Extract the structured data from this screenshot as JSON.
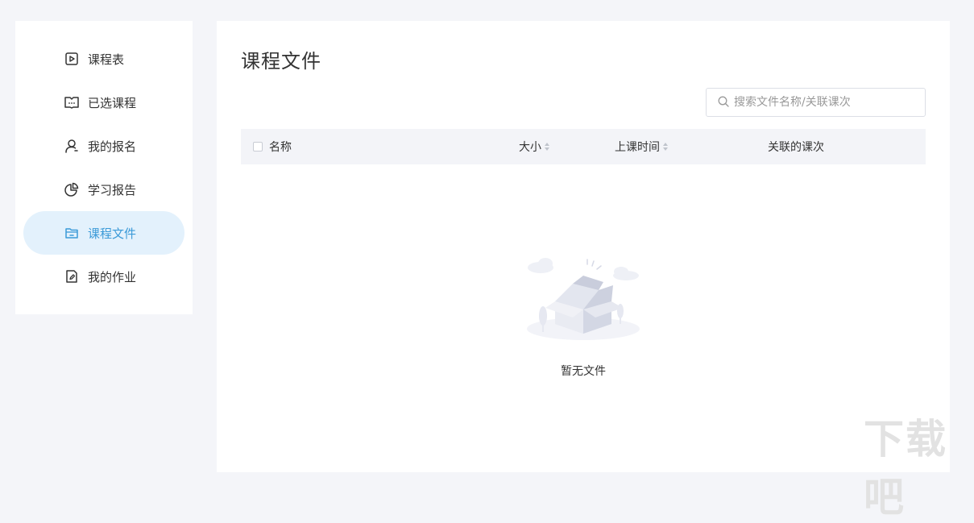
{
  "sidebar": {
    "items": [
      {
        "label": "课程表",
        "icon": "play-square-icon",
        "active": false
      },
      {
        "label": "已选课程",
        "icon": "book-open-icon",
        "active": false
      },
      {
        "label": "我的报名",
        "icon": "user-icon",
        "active": false
      },
      {
        "label": "学习报告",
        "icon": "pie-chart-icon",
        "active": false
      },
      {
        "label": "课程文件",
        "icon": "folder-icon",
        "active": true
      },
      {
        "label": "我的作业",
        "icon": "edit-document-icon",
        "active": false
      }
    ]
  },
  "main": {
    "title": "课程文件",
    "search": {
      "placeholder": "搜索文件名称/关联课次",
      "value": ""
    },
    "table": {
      "columns": [
        "名称",
        "大小",
        "上课时间",
        "关联的课次"
      ]
    },
    "empty_text": "暂无文件"
  },
  "watermark": "下载吧",
  "colors": {
    "accent": "#3b9ad8",
    "active_bg": "#e3f1fc",
    "page_bg": "#f4f5f9",
    "header_bg": "#f3f4f8"
  }
}
